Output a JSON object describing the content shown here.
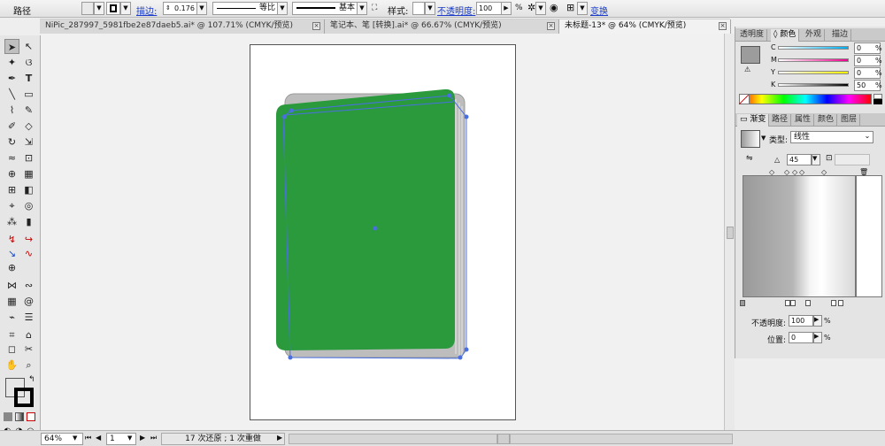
{
  "control_bar": {
    "object_type": "路径",
    "stroke_link": "描边:",
    "stroke_weight": "0.176",
    "profile": "等比",
    "brush": "基本",
    "style_label": "样式:",
    "opacity_link": "不透明度:",
    "opacity_value": "100",
    "opacity_unit": "%",
    "transform_link": "变换"
  },
  "tabs": [
    {
      "label": "NiPic_287997_5981fbe2e87daeb5.ai* @ 107.71% (CMYK/预览)",
      "active": false
    },
    {
      "label": "笔记本、笔 [转换].ai* @ 66.67% (CMYK/预览)",
      "active": false
    },
    {
      "label": "未标题-13* @ 64% (CMYK/预览)",
      "active": true
    }
  ],
  "color_panel": {
    "tabs": [
      "透明度",
      "颜色",
      "外观",
      "描边"
    ],
    "channels": [
      {
        "label": "C",
        "value": "0",
        "color": "#00aeef"
      },
      {
        "label": "M",
        "value": "0",
        "color": "#ec008c"
      },
      {
        "label": "Y",
        "value": "0",
        "color": "#fff200"
      },
      {
        "label": "K",
        "value": "50",
        "color": "#000000"
      }
    ],
    "unit": "%"
  },
  "gradient_panel": {
    "tabs": [
      "渐变",
      "路径",
      "属性",
      "颜色",
      "图层"
    ],
    "type_label": "类型:",
    "type_value": "线性",
    "angle_value": "45",
    "opacity_label": "不透明度:",
    "opacity_value": "100",
    "position_label": "位置:",
    "position_value": "0",
    "unit": "%"
  },
  "status_bar": {
    "zoom": "64%",
    "page": "1",
    "history": "17 次还原 ; 1 次重做"
  },
  "colors": {
    "book_cover": "#2a9a3d",
    "book_pages": "#b9b9b9",
    "selection": "#4a6fe0"
  }
}
